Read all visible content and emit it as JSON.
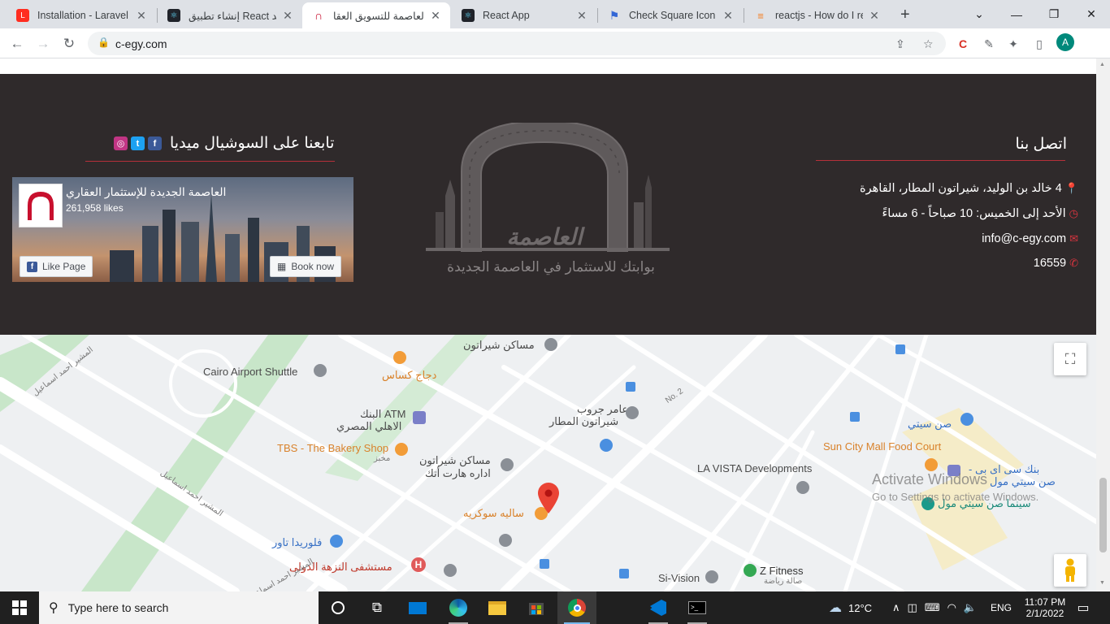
{
  "browser": {
    "tabs": [
      {
        "label": "Installation - Laravel -",
        "favicon_color": "#ff2d20",
        "active": false
      },
      {
        "label": "إنشاء تطبيق React جديد",
        "favicon_color": "#20232a",
        "active": false
      },
      {
        "label": "العاصمة للتسويق العقا",
        "favicon_color": "#c8102e",
        "active": true
      },
      {
        "label": "React App",
        "favicon_color": "#20232a",
        "active": false
      },
      {
        "label": "Check Square Icon - R",
        "favicon_color": "#3367d6",
        "active": false
      },
      {
        "label": "reactjs - How do I refe",
        "favicon_color": "#f48024",
        "active": false
      }
    ],
    "new_tab_label": "+",
    "url": "c-egy.com"
  },
  "footer": {
    "contact": {
      "title": "اتصل بنا",
      "address": "4 خالد بن الوليد، شيراتون المطار، القاهرة",
      "hours": "الأحد إلى الخميس: 10 صباحاً - 6 مساءً",
      "email": "info@c-egy.com",
      "phone": "16559"
    },
    "logo": {
      "name": "العاصمة",
      "tagline": "بوابتك للاستثمار في العاصمة الجديدة"
    },
    "social": {
      "title": "تابعنا على السوشيال ميديا",
      "fb_page_name": "العاصمة الجديدة للإستثمار العقاري",
      "fb_likes": "261,958 likes",
      "like_button": "Like Page",
      "book_button": "Book now"
    }
  },
  "map": {
    "labels": {
      "cairo_airport_shuttle": "Cairo Airport Shuttle",
      "mesaken_sheraton_top": "مساكن شيراتون",
      "dajaj_kasas": "دجاج كساس",
      "atm": "البنك ATM",
      "atm2": "الاهلي المصري",
      "tbs": "TBS - The Bakery Shop",
      "tbs_sub": "مخبز",
      "mesaken_sheraton_admin": "مساكن شيراتون",
      "mesaken_sheraton_admin2": "اداره هارت أتك",
      "amer_group": "عامر جروب",
      "amer_group2": "شيراتون المطار",
      "salih_sokariya": "ساليه سوكريه",
      "florida_tower": "فلوريدا تاور",
      "nozha_hospital": "مستشفى النزهة الدولى",
      "la_vista": "LA VISTA Developments",
      "sun_city_food": "Sun City Mall Food Court",
      "sun_city_blue": "صن سيتي",
      "cib_bank": "بنك سى اى بى -",
      "cib_bank2": "صن سيتي مول",
      "sun_city_cinema": "سينما صن سيتي مول",
      "z_fitness": "Z Fitness",
      "z_fitness_sub": "صالة رياضة",
      "si_vision": "Si-Vision",
      "no2": "No. 2",
      "road_mosheer1": "المشير احمد اسماعيل",
      "road_mosheer2": "المشير احمد اسماعيل",
      "road_mosheer3": "المشير احمد اسماعيل"
    }
  },
  "watermark": {
    "line1": "Activate Windows",
    "line2": "Go to Settings to activate Windows."
  },
  "taskbar": {
    "search_placeholder": "Type here to search",
    "temperature": "12°C",
    "language": "ENG",
    "time": "11:07 PM",
    "date": "2/1/2022"
  }
}
